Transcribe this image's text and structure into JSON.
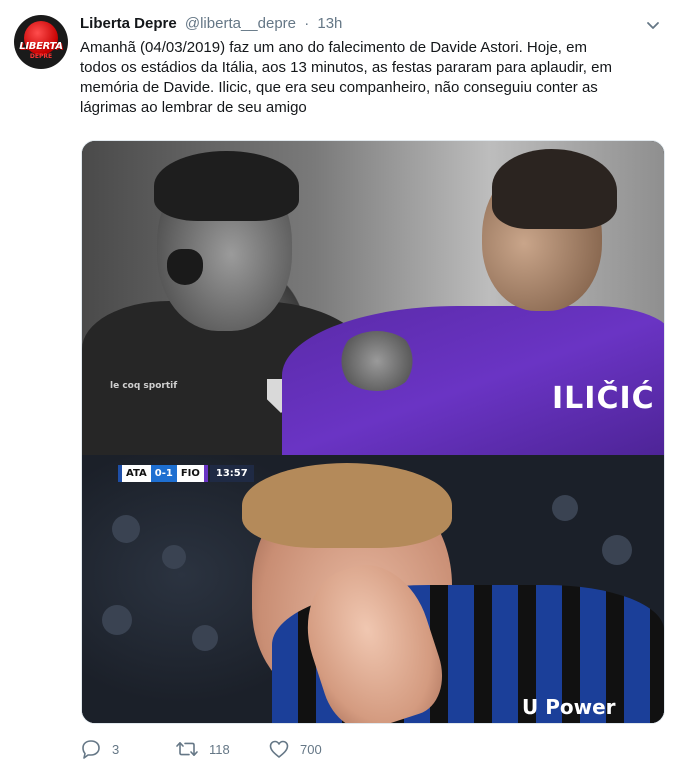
{
  "tweet": {
    "display_name": "Liberta Depre",
    "handle": "@liberta__depre",
    "separator": "·",
    "time": "13h",
    "text_lines": [
      "Amanhã (04/03/2019) faz um ano do falecimento de Davide Astori. Hoje, em",
      "todos os estádios da Itália, aos 13 minutos, as festas pararam para aplaudir, em",
      "memória de Davide. Ilicic, que era seu companheiro, não conseguiu conter as",
      "lágrimas ao lembrar de seu amigo"
    ]
  },
  "avatar": {
    "logo_text": "LIBERTA",
    "logo_sub": "DEPRE",
    "colors": {
      "background": "#1a1a1a",
      "accent": "#c40000"
    }
  },
  "media": {
    "top_photo": {
      "sponsor": "le coq sportif",
      "shirt_name": "ILIČIĆ"
    },
    "bottom_photo": {
      "scorebug": {
        "home": "ATA",
        "score": "0-1",
        "away": "FIO",
        "clock": "13:57"
      },
      "sponsor": "U Power"
    }
  },
  "actions": {
    "reply": {
      "icon": "reply-icon",
      "count": "3"
    },
    "retweet": {
      "icon": "retweet-icon",
      "count": "118"
    },
    "like": {
      "icon": "heart-icon",
      "count": "700"
    }
  },
  "menu": {
    "icon": "chevron-down-icon"
  },
  "colors": {
    "text": "#14171a",
    "muted": "#657786",
    "border": "#e1e8ed"
  }
}
